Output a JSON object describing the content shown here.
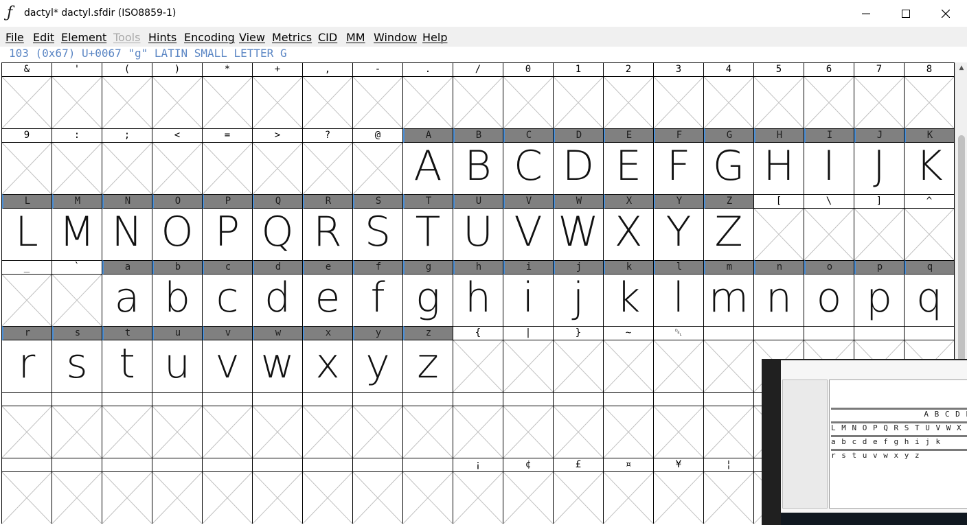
{
  "window": {
    "title": "dactyl*  dactyl.sfdir (ISO8859-1)",
    "app_icon": "fontforge-icon",
    "controls": [
      "minimize-icon",
      "maximize-icon",
      "close-icon"
    ]
  },
  "menu": {
    "items": [
      {
        "label": "File",
        "enabled": true
      },
      {
        "label": "Edit",
        "enabled": true
      },
      {
        "label": "Element",
        "enabled": true
      },
      {
        "label": "Tools",
        "enabled": false
      },
      {
        "label": "Hints",
        "enabled": true
      },
      {
        "label": "Encoding",
        "enabled": true
      },
      {
        "label": "View",
        "enabled": true
      },
      {
        "label": "Metrics",
        "enabled": true
      },
      {
        "label": "CID",
        "enabled": true
      },
      {
        "label": "MM",
        "enabled": true
      },
      {
        "label": "Window",
        "enabled": true
      },
      {
        "label": "Help",
        "enabled": true
      }
    ]
  },
  "glyph_info": "103 (0x67) U+0067 \"g\" LATIN SMALL LETTER G",
  "colors": {
    "filled_header": "#808080",
    "selected_border": "#4a90d9",
    "info_text": "#5b86c4"
  },
  "grid": {
    "rows": [
      {
        "cells": [
          {
            "label": "&",
            "glyph": ""
          },
          {
            "label": "'",
            "glyph": ""
          },
          {
            "label": "(",
            "glyph": ""
          },
          {
            "label": ")",
            "glyph": ""
          },
          {
            "label": "*",
            "glyph": ""
          },
          {
            "label": "+",
            "glyph": ""
          },
          {
            "label": ",",
            "glyph": ""
          },
          {
            "label": "-",
            "glyph": ""
          },
          {
            "label": ".",
            "glyph": ""
          },
          {
            "label": "/",
            "glyph": ""
          },
          {
            "label": "0",
            "glyph": ""
          },
          {
            "label": "1",
            "glyph": ""
          },
          {
            "label": "2",
            "glyph": ""
          },
          {
            "label": "3",
            "glyph": ""
          },
          {
            "label": "4",
            "glyph": ""
          },
          {
            "label": "5",
            "glyph": ""
          },
          {
            "label": "6",
            "glyph": ""
          },
          {
            "label": "7",
            "glyph": ""
          },
          {
            "label": "8",
            "glyph": ""
          }
        ]
      },
      {
        "cells": [
          {
            "label": "9",
            "glyph": ""
          },
          {
            "label": ":",
            "glyph": ""
          },
          {
            "label": ";",
            "glyph": ""
          },
          {
            "label": "<",
            "glyph": ""
          },
          {
            "label": "=",
            "glyph": ""
          },
          {
            "label": ">",
            "glyph": ""
          },
          {
            "label": "?",
            "glyph": ""
          },
          {
            "label": "@",
            "glyph": ""
          },
          {
            "label": "A",
            "glyph": "A"
          },
          {
            "label": "B",
            "glyph": "B"
          },
          {
            "label": "C",
            "glyph": "C"
          },
          {
            "label": "D",
            "glyph": "D"
          },
          {
            "label": "E",
            "glyph": "E"
          },
          {
            "label": "F",
            "glyph": "F"
          },
          {
            "label": "G",
            "glyph": "G"
          },
          {
            "label": "H",
            "glyph": "H"
          },
          {
            "label": "I",
            "glyph": "I"
          },
          {
            "label": "J",
            "glyph": "J"
          },
          {
            "label": "K",
            "glyph": "K"
          }
        ]
      },
      {
        "cells": [
          {
            "label": "L",
            "glyph": "L"
          },
          {
            "label": "M",
            "glyph": "M"
          },
          {
            "label": "N",
            "glyph": "N"
          },
          {
            "label": "O",
            "glyph": "O"
          },
          {
            "label": "P",
            "glyph": "P"
          },
          {
            "label": "Q",
            "glyph": "Q"
          },
          {
            "label": "R",
            "glyph": "R"
          },
          {
            "label": "S",
            "glyph": "S"
          },
          {
            "label": "T",
            "glyph": "T"
          },
          {
            "label": "U",
            "glyph": "U"
          },
          {
            "label": "V",
            "glyph": "V"
          },
          {
            "label": "W",
            "glyph": "W"
          },
          {
            "label": "X",
            "glyph": "X"
          },
          {
            "label": "Y",
            "glyph": "Y"
          },
          {
            "label": "Z",
            "glyph": "Z"
          },
          {
            "label": "[",
            "glyph": ""
          },
          {
            "label": "\\",
            "glyph": ""
          },
          {
            "label": "]",
            "glyph": ""
          },
          {
            "label": "^",
            "glyph": ""
          }
        ]
      },
      {
        "cells": [
          {
            "label": "_",
            "glyph": ""
          },
          {
            "label": "`",
            "glyph": ""
          },
          {
            "label": "a",
            "glyph": "a"
          },
          {
            "label": "b",
            "glyph": "b"
          },
          {
            "label": "c",
            "glyph": "c"
          },
          {
            "label": "d",
            "glyph": "d"
          },
          {
            "label": "e",
            "glyph": "e"
          },
          {
            "label": "f",
            "glyph": "f"
          },
          {
            "label": "g",
            "glyph": "g"
          },
          {
            "label": "h",
            "glyph": "h"
          },
          {
            "label": "i",
            "glyph": "i"
          },
          {
            "label": "j",
            "glyph": "j"
          },
          {
            "label": "k",
            "glyph": "k"
          },
          {
            "label": "l",
            "glyph": "l"
          },
          {
            "label": "m",
            "glyph": "m"
          },
          {
            "label": "n",
            "glyph": "n"
          },
          {
            "label": "o",
            "glyph": "o"
          },
          {
            "label": "p",
            "glyph": "p"
          },
          {
            "label": "q",
            "glyph": "q"
          }
        ]
      },
      {
        "cells": [
          {
            "label": "r",
            "glyph": "r"
          },
          {
            "label": "s",
            "glyph": "s"
          },
          {
            "label": "t",
            "glyph": "t"
          },
          {
            "label": "u",
            "glyph": "u"
          },
          {
            "label": "v",
            "glyph": "v"
          },
          {
            "label": "w",
            "glyph": "w"
          },
          {
            "label": "x",
            "glyph": "x"
          },
          {
            "label": "y",
            "glyph": "y"
          },
          {
            "label": "z",
            "glyph": "z"
          },
          {
            "label": "{",
            "glyph": ""
          },
          {
            "label": "|",
            "glyph": ""
          },
          {
            "label": "}",
            "glyph": ""
          },
          {
            "label": "~",
            "glyph": ""
          },
          {
            "label": "␡",
            "glyph": ""
          },
          {
            "label": "",
            "glyph": ""
          },
          {
            "label": "",
            "glyph": ""
          },
          {
            "label": "",
            "glyph": ""
          },
          {
            "label": "",
            "glyph": ""
          },
          {
            "label": "",
            "glyph": ""
          }
        ]
      },
      {
        "cells": [
          {
            "label": "",
            "glyph": ""
          },
          {
            "label": "",
            "glyph": ""
          },
          {
            "label": "",
            "glyph": ""
          },
          {
            "label": "",
            "glyph": ""
          },
          {
            "label": "",
            "glyph": ""
          },
          {
            "label": "",
            "glyph": ""
          },
          {
            "label": "",
            "glyph": ""
          },
          {
            "label": "",
            "glyph": ""
          },
          {
            "label": "",
            "glyph": ""
          },
          {
            "label": "",
            "glyph": ""
          },
          {
            "label": "",
            "glyph": ""
          },
          {
            "label": "",
            "glyph": ""
          },
          {
            "label": "",
            "glyph": ""
          },
          {
            "label": "",
            "glyph": ""
          },
          {
            "label": "",
            "glyph": ""
          },
          {
            "label": "",
            "glyph": ""
          },
          {
            "label": "",
            "glyph": ""
          },
          {
            "label": "",
            "glyph": ""
          },
          {
            "label": "",
            "glyph": ""
          }
        ]
      },
      {
        "cells": [
          {
            "label": "",
            "glyph": ""
          },
          {
            "label": "",
            "glyph": ""
          },
          {
            "label": "",
            "glyph": ""
          },
          {
            "label": "",
            "glyph": ""
          },
          {
            "label": "",
            "glyph": ""
          },
          {
            "label": "",
            "glyph": ""
          },
          {
            "label": "",
            "glyph": ""
          },
          {
            "label": "",
            "glyph": ""
          },
          {
            "label": "",
            "glyph": ""
          },
          {
            "label": "¡",
            "glyph": ""
          },
          {
            "label": "¢",
            "glyph": ""
          },
          {
            "label": "£",
            "glyph": ""
          },
          {
            "label": "¤",
            "glyph": ""
          },
          {
            "label": "¥",
            "glyph": ""
          },
          {
            "label": "¦",
            "glyph": ""
          },
          {
            "label": "",
            "glyph": ""
          },
          {
            "label": "",
            "glyph": ""
          },
          {
            "label": "",
            "glyph": ""
          },
          {
            "label": "",
            "glyph": ""
          }
        ]
      }
    ]
  },
  "thumbnail": {
    "rows": [
      "A B C D E",
      "L M N O P Q R S T U V W X",
      "a b c d e f g h i j k",
      "r s t u v w x y z"
    ]
  }
}
